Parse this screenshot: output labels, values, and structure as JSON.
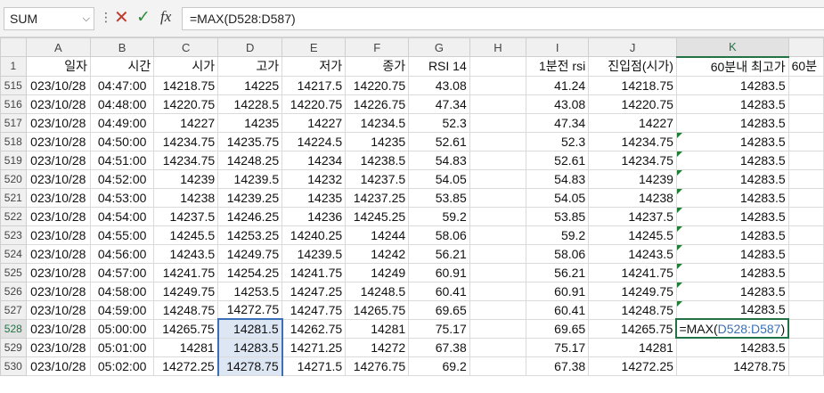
{
  "formula_bar": {
    "name_box": "SUM",
    "formula": "=MAX(D528:D587)"
  },
  "columns": [
    "A",
    "B",
    "C",
    "D",
    "E",
    "F",
    "G",
    "H",
    "I",
    "J",
    "K"
  ],
  "header_row": {
    "row_number": "1",
    "cells": [
      "일자",
      "시간",
      "시가",
      "고가",
      "저가",
      "종가",
      "RSI 14",
      "",
      "1분전 rsi",
      "진입점(시가)",
      "60분내 최고가",
      "60분"
    ]
  },
  "rows": [
    {
      "n": "515",
      "cells": [
        "023/10/28",
        "04:47:00",
        "14218.75",
        "14225",
        "14217.5",
        "14220.75",
        "43.08",
        "",
        "41.24",
        "14218.75",
        "14283.5"
      ]
    },
    {
      "n": "516",
      "cells": [
        "023/10/28",
        "04:48:00",
        "14220.75",
        "14228.5",
        "14220.75",
        "14226.75",
        "47.34",
        "",
        "43.08",
        "14220.75",
        "14283.5"
      ]
    },
    {
      "n": "517",
      "cells": [
        "023/10/28",
        "04:49:00",
        "14227",
        "14235",
        "14227",
        "14234.5",
        "52.3",
        "",
        "47.34",
        "14227",
        "14283.5"
      ]
    },
    {
      "n": "518",
      "cells": [
        "023/10/28",
        "04:50:00",
        "14234.75",
        "14235.75",
        "14224.5",
        "14235",
        "52.61",
        "",
        "52.3",
        "14234.75",
        "14283.5"
      ]
    },
    {
      "n": "519",
      "cells": [
        "023/10/28",
        "04:51:00",
        "14234.75",
        "14248.25",
        "14234",
        "14238.5",
        "54.83",
        "",
        "52.61",
        "14234.75",
        "14283.5"
      ]
    },
    {
      "n": "520",
      "cells": [
        "023/10/28",
        "04:52:00",
        "14239",
        "14239.5",
        "14232",
        "14237.5",
        "54.05",
        "",
        "54.83",
        "14239",
        "14283.5"
      ]
    },
    {
      "n": "521",
      "cells": [
        "023/10/28",
        "04:53:00",
        "14238",
        "14239.25",
        "14235",
        "14237.25",
        "53.85",
        "",
        "54.05",
        "14238",
        "14283.5"
      ]
    },
    {
      "n": "522",
      "cells": [
        "023/10/28",
        "04:54:00",
        "14237.5",
        "14246.25",
        "14236",
        "14245.25",
        "59.2",
        "",
        "53.85",
        "14237.5",
        "14283.5"
      ]
    },
    {
      "n": "523",
      "cells": [
        "023/10/28",
        "04:55:00",
        "14245.5",
        "14253.25",
        "14240.25",
        "14244",
        "58.06",
        "",
        "59.2",
        "14245.5",
        "14283.5"
      ]
    },
    {
      "n": "524",
      "cells": [
        "023/10/28",
        "04:56:00",
        "14243.5",
        "14249.75",
        "14239.5",
        "14242",
        "56.21",
        "",
        "58.06",
        "14243.5",
        "14283.5"
      ]
    },
    {
      "n": "525",
      "cells": [
        "023/10/28",
        "04:57:00",
        "14241.75",
        "14254.25",
        "14241.75",
        "14249",
        "60.91",
        "",
        "56.21",
        "14241.75",
        "14283.5"
      ]
    },
    {
      "n": "526",
      "cells": [
        "023/10/28",
        "04:58:00",
        "14249.75",
        "14253.5",
        "14247.25",
        "14248.5",
        "60.41",
        "",
        "60.91",
        "14249.75",
        "14283.5"
      ]
    },
    {
      "n": "527",
      "cells": [
        "023/10/28",
        "04:59:00",
        "14248.75",
        "14272.75",
        "14247.75",
        "14265.75",
        "69.65",
        "",
        "60.41",
        "14248.75",
        "14283.5"
      ]
    },
    {
      "n": "528",
      "cells": [
        "023/10/28",
        "05:00:00",
        "14265.75",
        "14281.5",
        "14262.75",
        "14281",
        "75.17",
        "",
        "69.65",
        "14265.75",
        ""
      ]
    },
    {
      "n": "529",
      "cells": [
        "023/10/28",
        "05:01:00",
        "14281",
        "14283.5",
        "14271.25",
        "14272",
        "67.38",
        "",
        "75.17",
        "14281",
        "14283.5"
      ]
    },
    {
      "n": "530",
      "cells": [
        "023/10/28",
        "05:02:00",
        "14272.25",
        "14278.75",
        "14271.5",
        "14276.75",
        "69.2",
        "",
        "67.38",
        "14272.25",
        "14278.75"
      ]
    }
  ],
  "active_cell_formula": {
    "prefix": "=MAX(",
    "ref": "D528:D587",
    "suffix": ")"
  }
}
